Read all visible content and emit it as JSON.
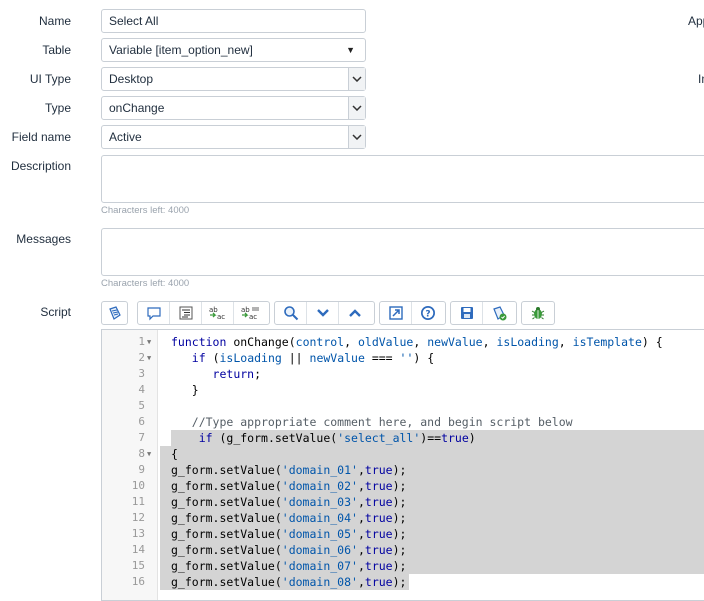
{
  "form": {
    "name": {
      "label": "Name",
      "value": "Select All"
    },
    "table": {
      "label": "Table",
      "value": "Variable [item_option_new]"
    },
    "ui_type": {
      "label": "UI Type",
      "value": "Desktop"
    },
    "type": {
      "label": "Type",
      "value": "onChange"
    },
    "field_name": {
      "label": "Field name",
      "value": "Active"
    },
    "description": {
      "label": "Description",
      "value": "",
      "chars_left": "Characters left: 4000"
    },
    "messages": {
      "label": "Messages",
      "value": "",
      "chars_left": "Characters left: 4000"
    },
    "script": {
      "label": "Script"
    }
  },
  "side_labels": {
    "application": "App",
    "inherited": "In"
  },
  "toolbar": {
    "buttons": [
      {
        "name": "toggle-syntax-editor",
        "icon": "script-icon"
      },
      {
        "name": "comment-selected-code",
        "icon": "comment-icon"
      },
      {
        "name": "format-code",
        "icon": "format-icon"
      },
      {
        "name": "replace",
        "icon": "replace-icon"
      },
      {
        "name": "replace-all",
        "icon": "replace-all-icon"
      },
      {
        "name": "search",
        "icon": "search-icon"
      },
      {
        "name": "find-next",
        "icon": "chevron-down-icon"
      },
      {
        "name": "find-previous",
        "icon": "chevron-up-icon"
      },
      {
        "name": "fullscreen",
        "icon": "expand-icon"
      },
      {
        "name": "help",
        "icon": "help-icon"
      },
      {
        "name": "save",
        "icon": "save-icon"
      },
      {
        "name": "toggle-script-debugger",
        "icon": "script-debugger-icon"
      },
      {
        "name": "debug",
        "icon": "bug-icon"
      }
    ]
  },
  "colors": {
    "accent": "#2e6bbd",
    "highlight": "#d4d4d4",
    "keyword": "#0000a0",
    "string": "#0055aa"
  },
  "code_lines": [
    {
      "num": "1",
      "fold": true,
      "text": "function onChange(control, oldValue, newValue, isLoading, isTemplate) {"
    },
    {
      "num": "2",
      "fold": true,
      "text": "   if (isLoading || newValue === '') {"
    },
    {
      "num": "3",
      "fold": false,
      "text": "      return;"
    },
    {
      "num": "4",
      "fold": false,
      "text": "   }"
    },
    {
      "num": "5",
      "fold": false,
      "text": ""
    },
    {
      "num": "6",
      "fold": false,
      "text": "   //Type appropriate comment here, and begin script below"
    },
    {
      "num": "7",
      "fold": false,
      "text": "    if (g_form.setValue('select_all')==true)"
    },
    {
      "num": "8",
      "fold": true,
      "text": "{"
    },
    {
      "num": "9",
      "fold": false,
      "text": "g_form.setValue('domain_01',true);"
    },
    {
      "num": "10",
      "fold": false,
      "text": "g_form.setValue('domain_02',true);"
    },
    {
      "num": "11",
      "fold": false,
      "text": "g_form.setValue('domain_03',true);"
    },
    {
      "num": "12",
      "fold": false,
      "text": "g_form.setValue('domain_04',true);"
    },
    {
      "num": "13",
      "fold": false,
      "text": "g_form.setValue('domain_05',true);"
    },
    {
      "num": "14",
      "fold": false,
      "text": "g_form.setValue('domain_06',true);"
    },
    {
      "num": "15",
      "fold": false,
      "text": "g_form.setValue('domain_07',true);"
    },
    {
      "num": "16",
      "fold": false,
      "text": "g_form.setValue('domain_08',true);"
    }
  ]
}
